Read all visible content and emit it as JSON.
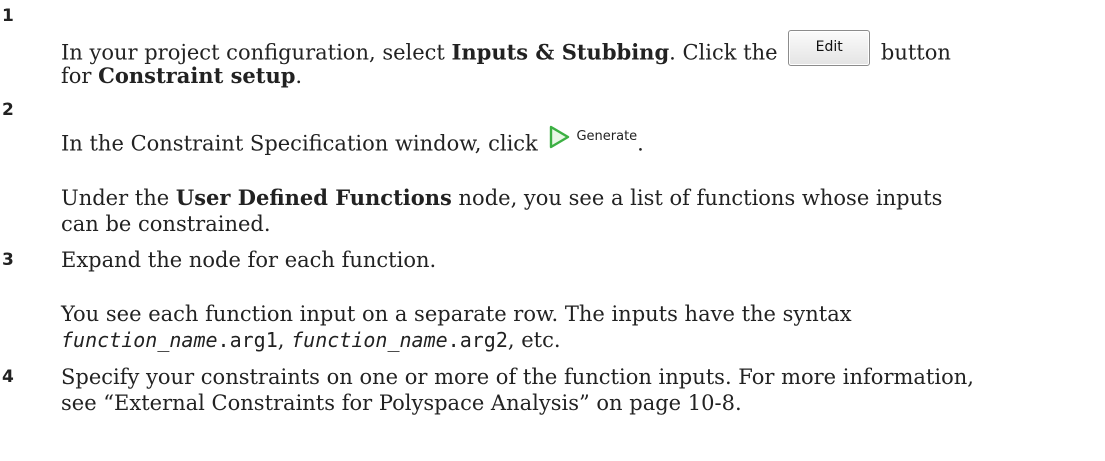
{
  "steps": [
    {
      "number": "1",
      "text_a": "In your project configuration, select ",
      "bold_a": "Inputs & Stubbing",
      "text_b": ". Click the ",
      "button_label": "Edit",
      "text_c": " button",
      "text_d": "for ",
      "bold_b": "Constraint setup",
      "text_e": "."
    },
    {
      "number": "2",
      "text_a": "In the Constraint Specification window, click ",
      "button_label": "Generate",
      "text_b": ".",
      "note_a": "Under the ",
      "note_bold": "User Defined Functions",
      "note_b": " node, you see a list of functions whose inputs",
      "note_c": "can be constrained."
    },
    {
      "number": "3",
      "text": "Expand the node for each function.",
      "note_a": "You see each function input on a separate row. The inputs have the syntax",
      "fn1": "function_name",
      "arg1": ".arg1",
      "sep1": ", ",
      "fn2": "function_name",
      "arg2": ".arg2",
      "tail": ", etc."
    },
    {
      "number": "4",
      "line1": "Specify your constraints on one or more of the function inputs. For more information,",
      "line2": "see “External Constraints for Polyspace Analysis” on page 10-8."
    }
  ],
  "colors": {
    "text": "#222222",
    "generate_icon": "#3cb043"
  },
  "icons": {
    "generate": "play-triangle-icon"
  }
}
